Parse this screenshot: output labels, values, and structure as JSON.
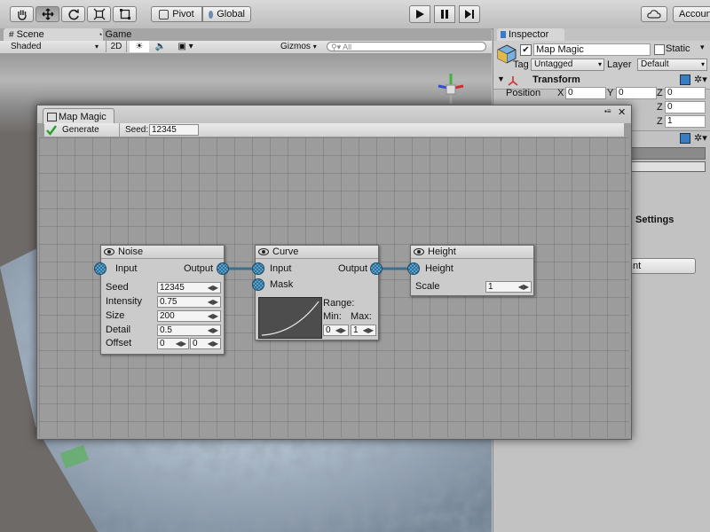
{
  "toolbar": {
    "tools": [
      "hand-icon",
      "move-icon",
      "rotate-icon",
      "scale-icon",
      "rect-tool-icon"
    ],
    "pivot_label": "Pivot",
    "global_label": "Global",
    "play_icons": [
      "play-icon",
      "pause-icon",
      "step-icon"
    ],
    "account_label": "Account"
  },
  "scene": {
    "tabs": [
      {
        "label": "Scene"
      },
      {
        "label": "Game"
      }
    ],
    "shading": "Shaded",
    "mode_2d": "2D",
    "gizmos": "Gizmos",
    "search_placeholder": "All"
  },
  "inspector": {
    "tab_label": "Inspector",
    "object_name": "Map Magic",
    "static_label": "Static",
    "tag_label": "Tag",
    "tag_value": "Untagged",
    "layer_label": "Layer",
    "layer_value": "Default",
    "transform_title": "Transform",
    "position_label": "Position",
    "axis_x": "X",
    "axis_y": "Y",
    "axis_z": "Z",
    "pos_x": "0",
    "pos_y": "0",
    "pos_z": "0",
    "rot_z": "0",
    "scale_z": "1",
    "settings_partial": "Settings",
    "button_partial": "nt"
  },
  "mapmagic": {
    "title": "Map Magic",
    "generate_label": "Generate",
    "seed_label": "Seed:",
    "seed_value": "12345",
    "nodes": {
      "noise": {
        "title": "Noise",
        "input": "Input",
        "output": "Output",
        "fields": [
          {
            "label": "Seed",
            "value": "12345"
          },
          {
            "label": "Intensity",
            "value": "0.75"
          },
          {
            "label": "Size",
            "value": "200"
          },
          {
            "label": "Detail",
            "value": "0.5"
          }
        ],
        "offset_label": "Offset",
        "offset_x": "0",
        "offset_y": "0"
      },
      "curve": {
        "title": "Curve",
        "input": "Input",
        "output": "Output",
        "mask": "Mask",
        "range_label": "Range:",
        "min_label": "Min:",
        "max_label": "Max:",
        "min_value": "0",
        "max_value": "1"
      },
      "height": {
        "title": "Height",
        "input": "Height",
        "scale_label": "Scale",
        "scale_value": "1"
      }
    }
  }
}
